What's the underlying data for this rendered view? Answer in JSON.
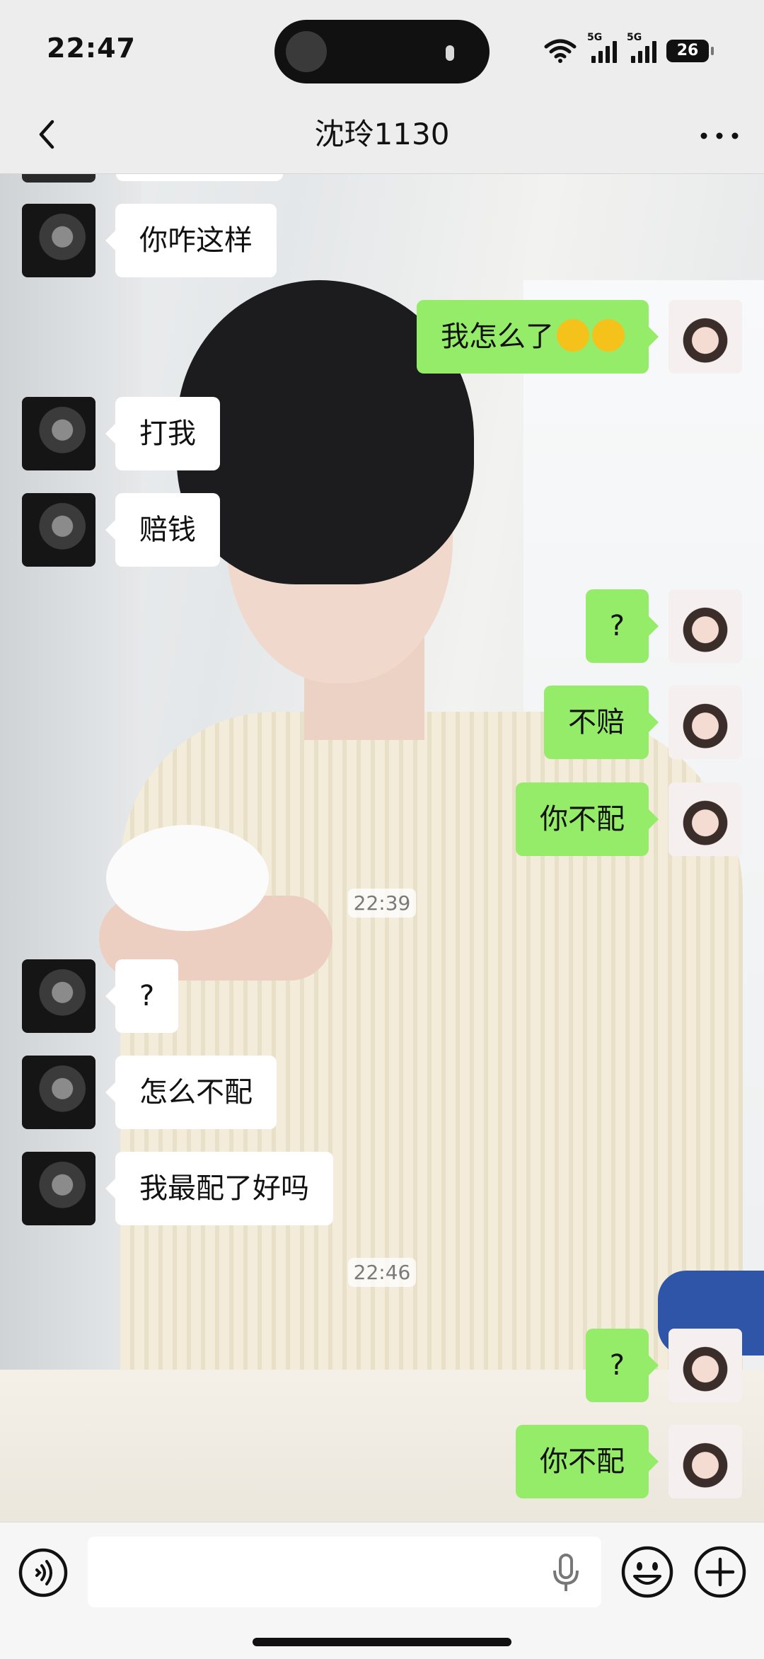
{
  "status_bar": {
    "time": "22:47",
    "network_1": "5G",
    "network_2": "5G",
    "battery": "26"
  },
  "header": {
    "title": "沈玲1130"
  },
  "messages": [
    {
      "side": "left",
      "text": "你咋这样"
    },
    {
      "side": "right",
      "text": "我怎么了"
    },
    {
      "side": "left",
      "text": "打我"
    },
    {
      "side": "left",
      "text": "赔钱"
    },
    {
      "side": "right",
      "text": "?"
    },
    {
      "side": "right",
      "text": "不赔"
    },
    {
      "side": "right",
      "text": "你不配"
    },
    {
      "side": "left",
      "text": "?"
    },
    {
      "side": "left",
      "text": "怎么不配"
    },
    {
      "side": "left",
      "text": "我最配了好吗"
    },
    {
      "side": "right",
      "text": "?"
    },
    {
      "side": "right",
      "text": "你不配"
    }
  ],
  "timestamps": [
    "22:39",
    "22:46"
  ],
  "icons": {
    "back": "chevron-left-icon",
    "more": "more-dots-icon",
    "voice": "voice-icon",
    "mic": "microphone-icon",
    "emoji": "smiley-icon",
    "plus": "plus-icon"
  },
  "colors": {
    "my_bubble": "#95ec69",
    "their_bubble": "#ffffff",
    "background": "#ededed"
  }
}
